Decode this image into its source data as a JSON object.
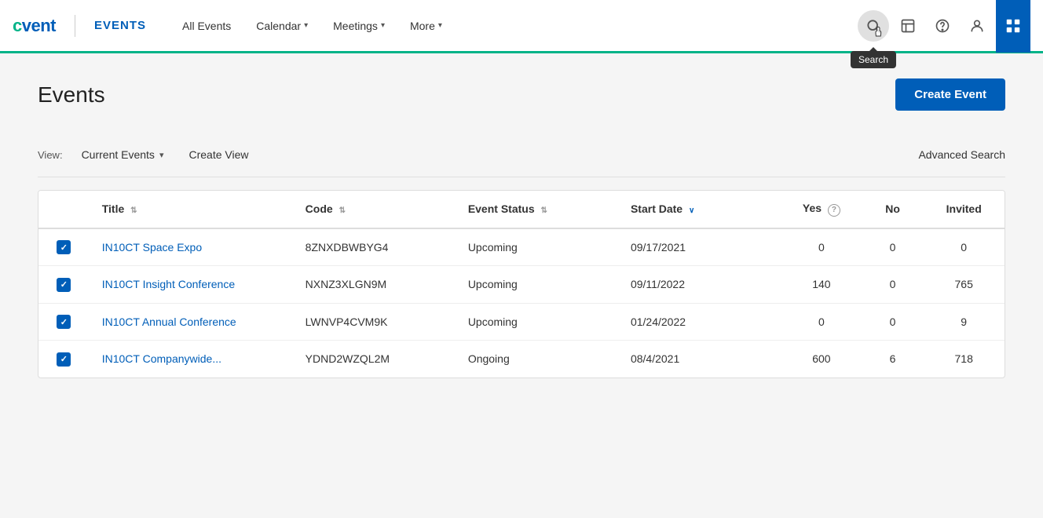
{
  "header": {
    "logo_c": "c",
    "logo_vent": "vent",
    "logo_divider": "|",
    "logo_events": "EVENTS",
    "nav": [
      {
        "label": "All Events",
        "hasChevron": false
      },
      {
        "label": "Calendar",
        "hasChevron": true
      },
      {
        "label": "Meetings",
        "hasChevron": true
      },
      {
        "label": "More",
        "hasChevron": true
      }
    ],
    "search_tooltip": "Search"
  },
  "page": {
    "title": "Events",
    "create_event_label": "Create Event"
  },
  "view_bar": {
    "view_label": "View:",
    "current_view": "Current Events",
    "create_view": "Create View",
    "advanced_search": "Advanced Search"
  },
  "table": {
    "columns": [
      {
        "key": "title",
        "label": "Title",
        "sortable": true
      },
      {
        "key": "code",
        "label": "Code",
        "sortable": true
      },
      {
        "key": "status",
        "label": "Event Status",
        "sortable": true
      },
      {
        "key": "startDate",
        "label": "Start Date",
        "sortable": true,
        "sorted": true
      },
      {
        "key": "yes",
        "label": "Yes",
        "sortable": false,
        "hasHelp": true
      },
      {
        "key": "no",
        "label": "No",
        "sortable": false
      },
      {
        "key": "invited",
        "label": "Invited",
        "sortable": false
      }
    ],
    "rows": [
      {
        "title": "IN10CT Space Expo",
        "code": "8ZNXDBWBYG4",
        "status": "Upcoming",
        "startDate": "09/17/2021",
        "yes": "0",
        "no": "0",
        "invited": "0"
      },
      {
        "title": "IN10CT Insight Conference",
        "code": "NXNZ3XLGN9M",
        "status": "Upcoming",
        "startDate": "09/11/2022",
        "yes": "140",
        "no": "0",
        "invited": "765"
      },
      {
        "title": "IN10CT Annual Conference",
        "code": "LWNVP4CVM9K",
        "status": "Upcoming",
        "startDate": "01/24/2022",
        "yes": "0",
        "no": "0",
        "invited": "9"
      },
      {
        "title": "IN10CT Companywide...",
        "code": "YDND2WZQL2M",
        "status": "Ongoing",
        "startDate": "08/4/2021",
        "yes": "600",
        "no": "6",
        "invited": "718"
      }
    ]
  }
}
